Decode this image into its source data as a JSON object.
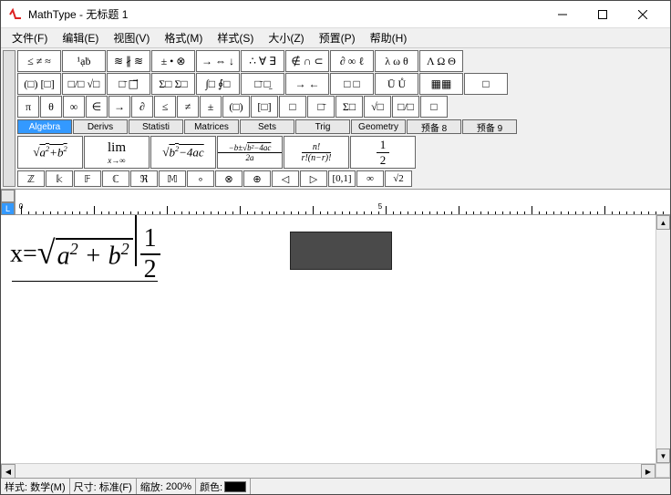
{
  "title": "MathType - 无标题 1",
  "menu": {
    "file": "文件(F)",
    "edit": "编辑(E)",
    "view": "视图(V)",
    "format": "格式(M)",
    "style": "样式(S)",
    "size": "大小(Z)",
    "preferences": "预置(P)",
    "help": "帮助(H)"
  },
  "palette": {
    "row1": [
      "≤ ≠ ≈",
      "¹ạḃ",
      "≋ ∦ ≋",
      "± • ⊗",
      "→ ⇔ ↓",
      "∴ ∀ ∃",
      "∉ ∩ ⊂",
      "∂ ∞ ℓ",
      "λ ω θ",
      "Λ Ω Θ"
    ],
    "row2": [
      "(□) [□]",
      "□/□ √□",
      "□̄ □⃗",
      "Σ□ Σ□",
      "∫□ ∮□",
      "□̄ □̱",
      "→ ←",
      "□ □",
      "Ū Ů",
      "▦▦",
      "□"
    ],
    "row3": [
      "π",
      "θ",
      "∞",
      "∈",
      "→",
      "∂",
      "≤",
      "≠",
      "±",
      "(□)",
      "[□]",
      "□",
      "□̄",
      "Σ□",
      "√□",
      "□/□",
      "□"
    ]
  },
  "tabs": [
    "Algebra",
    "Derivs",
    "Statisti",
    "Matrices",
    "Sets",
    "Trig",
    "Geometry",
    "预备 8",
    "预备 9"
  ],
  "bigbtns": [
    "√(a²+b²)",
    "lim x→∞",
    "√(b²−4ac)",
    "(−b±√(b²−4ac))/2a",
    "n!/(r!(n−r)!)",
    "1/2"
  ],
  "smallrow": [
    "ℤ",
    "𝕜",
    "𝔽",
    "ℂ",
    "ℜ",
    "𝕄",
    "∘",
    "⊗",
    "⊕",
    "◁",
    "▷",
    "[0,1]",
    "∞",
    "√2"
  ],
  "ruler": {
    "zero": "0",
    "five": "5"
  },
  "equation": {
    "lhs": "x=",
    "radicand_a": "a",
    "radicand_plus": " + ",
    "radicand_b": "b",
    "sup": "2",
    "frac_top": "1",
    "frac_bot": "2"
  },
  "status": {
    "style_label": "样式:",
    "style_value": "数学(M)",
    "size_label": "尺寸:",
    "size_value": "标准(F)",
    "zoom_label": "缩放:",
    "zoom_value": "200%",
    "color_label": "颜色:"
  }
}
